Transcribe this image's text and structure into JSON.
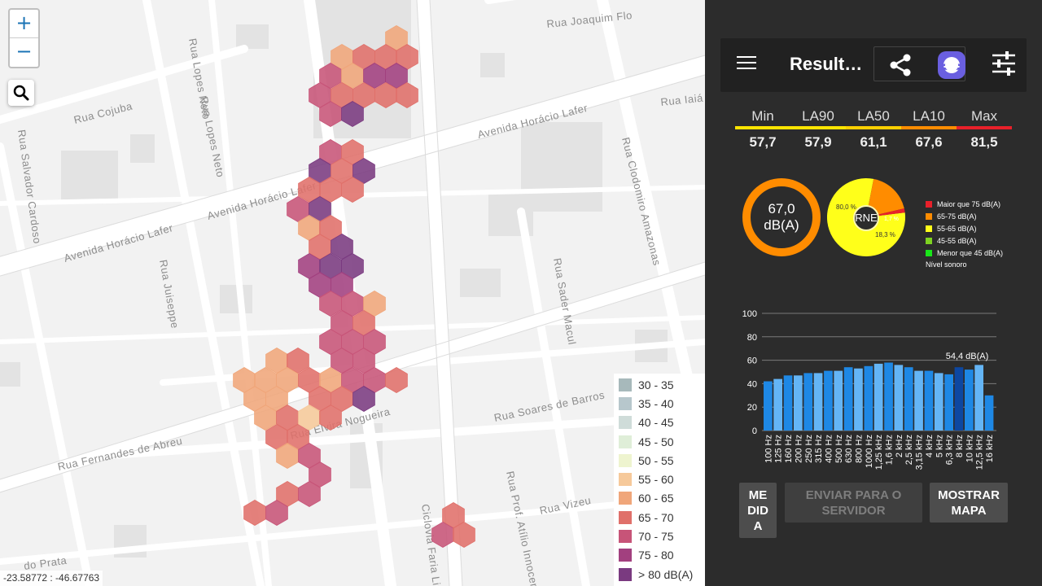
{
  "map": {
    "zoom_in": "+",
    "zoom_out": "−",
    "coordinates": "-23.58772 : -46.67763",
    "streets": [
      "Rua Joaquim Flo",
      "Rua Lopes Neto",
      "Rua Cojuba",
      "Rua Lopes Neto",
      "Rua Salvador Cardoso",
      "Avenida Horácio Lafer",
      "Avenida Horácio Lafer",
      "Avenida Horácio Lafer",
      "Rua Juiseppe",
      "Rua Clodomiro Amazonas",
      "Rua Sader Macul",
      "Rua Soares de Barros",
      "Rua Fernandes de Abreu",
      "Rua Prof. Atílio Innocenti",
      "Rua Vizeu",
      "Ciclovia Faria Lima",
      "Rua Elvira Nogueira",
      "Rua Iaiá",
      "do Prata"
    ],
    "legend": [
      {
        "label": "30 - 35",
        "color": "#a7b9bb"
      },
      {
        "label": "35 - 40",
        "color": "#b7c7cc"
      },
      {
        "label": "40 - 45",
        "color": "#cfdcd9"
      },
      {
        "label": "45 - 50",
        "color": "#dfeed8"
      },
      {
        "label": "50 - 55",
        "color": "#eef4cf"
      },
      {
        "label": "55 - 60",
        "color": "#f6c99a"
      },
      {
        "label": "60 - 65",
        "color": "#f0a67a"
      },
      {
        "label": "65 - 70",
        "color": "#e0706a"
      },
      {
        "label": "70 - 75",
        "color": "#c75478"
      },
      {
        "label": "75 - 80",
        "color": "#a2407f"
      },
      {
        "label": "> 80 dB(A)",
        "color": "#7a3a80"
      }
    ]
  },
  "app": {
    "title": "Result…",
    "stats": [
      {
        "label": "Min",
        "value": "57,7",
        "color": "#ffe500"
      },
      {
        "label": "LA90",
        "value": "57,9",
        "color": "#ffe500"
      },
      {
        "label": "LA50",
        "value": "61,1",
        "color": "#ffd000"
      },
      {
        "label": "LA10",
        "value": "67,6",
        "color": "#ff8c00"
      },
      {
        "label": "Max",
        "value": "81,5",
        "color": "#e8202a"
      }
    ],
    "level_value": "67,0",
    "level_unit": "dB(A)",
    "pie": {
      "center_label": "RNE",
      "slices": [
        {
          "label": "80,0 %",
          "value": 80.0,
          "color": "#ffff1a"
        },
        {
          "label": "18,3 %",
          "value": 18.3,
          "color": "#ff8c00"
        },
        {
          "label": "1,7 %",
          "value": 1.7,
          "color": "#e8202a"
        }
      ]
    },
    "pie_legend": [
      {
        "label": "Maior que 75 dB(A)",
        "color": "#e8202a"
      },
      {
        "label": "65-75 dB(A)",
        "color": "#ff8c00"
      },
      {
        "label": "55-65 dB(A)",
        "color": "#ffff1a"
      },
      {
        "label": "45-55 dB(A)",
        "color": "#7ed321"
      },
      {
        "label": "Menor que 45 dB(A)",
        "color": "#19e619"
      }
    ],
    "pie_legend_title": "Nível sonoro",
    "buttons": {
      "medida": "ME\nDID\nA",
      "enviar": "ENVIAR PARA O SERVIDOR",
      "mapa": "MOSTRAR MAPA"
    }
  },
  "chart_data": {
    "type": "bar",
    "categories": [
      "100 Hz",
      "125 Hz",
      "160 Hz",
      "200 Hz",
      "250 Hz",
      "315 Hz",
      "400 Hz",
      "500 Hz",
      "630 Hz",
      "800 Hz",
      "1000 Hz",
      "1,25 kHz",
      "1,6 kHz",
      "2 kHz",
      "2,5 kHz",
      "3,15 kHz",
      "4 kHz",
      "5 kHz",
      "6,3 kHz",
      "8 kHz",
      "10 kHz",
      "12,5 kHz",
      "16 kHz"
    ],
    "values": [
      42,
      44,
      47,
      47,
      49,
      49,
      51,
      51,
      54,
      53,
      55,
      57,
      58,
      56,
      54,
      51,
      51,
      49,
      48,
      54,
      52,
      56,
      30
    ],
    "ylim": [
      0,
      100
    ],
    "yticks": [
      0,
      20,
      40,
      60,
      80,
      100
    ],
    "highlight_index": 19,
    "highlight_label": "54,4 dB(A)",
    "colors": {
      "normal": "#1e88e5",
      "alt": "#64b5f6",
      "highlight": "#0d47a1"
    }
  }
}
